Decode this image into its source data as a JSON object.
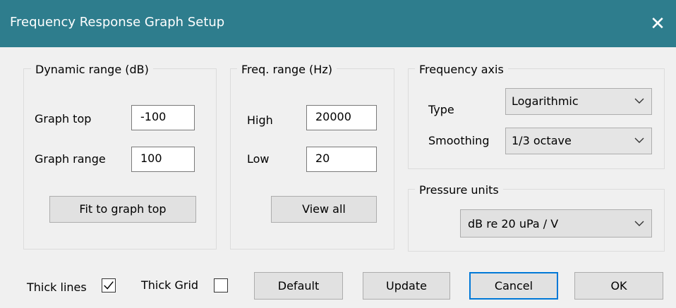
{
  "window": {
    "title": "Frequency Response Graph Setup",
    "close_glyph": "✕"
  },
  "dynamic_range": {
    "legend": "Dynamic range (dB)",
    "graph_top_label": "Graph top",
    "graph_top_value": "-100",
    "graph_range_label": "Graph range",
    "graph_range_value": "100",
    "fit_button": "Fit to graph top"
  },
  "freq_range": {
    "legend": "Freq. range (Hz)",
    "high_label": "High",
    "high_value": "20000",
    "low_label": "Low",
    "low_value": "20",
    "view_all_button": "View all"
  },
  "frequency_axis": {
    "legend": "Frequency axis",
    "type_label": "Type",
    "type_value": "Logarithmic",
    "smoothing_label": "Smoothing",
    "smoothing_value": "1/3 octave"
  },
  "pressure_units": {
    "legend": "Pressure units",
    "value": "dB re 20 uPa / V"
  },
  "footer": {
    "thick_lines_label": "Thick lines",
    "thick_lines_checked": true,
    "thick_grid_label": "Thick Grid",
    "thick_grid_checked": false,
    "default_button": "Default",
    "update_button": "Update",
    "cancel_button": "Cancel",
    "ok_button": "OK"
  },
  "colors": {
    "titlebar": "#2e7d8d",
    "focus_border": "#0078d7"
  },
  "icons": {
    "close": "close-icon",
    "dropdown": "chevron-down-icon",
    "checkmark": "checkmark-icon"
  }
}
